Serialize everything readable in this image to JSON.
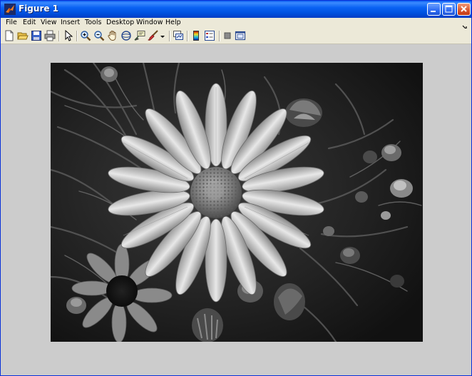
{
  "window": {
    "title": "Figure 1"
  },
  "menu": {
    "items": [
      "File",
      "Edit",
      "View",
      "Insert",
      "Tools",
      "Desktop",
      "Window",
      "Help"
    ]
  },
  "toolbar": {
    "buttons": [
      {
        "icon": "new-figure-icon"
      },
      {
        "icon": "open-file-icon"
      },
      {
        "icon": "save-icon"
      },
      {
        "icon": "print-icon"
      },
      {
        "icon": "edit-plot-arrow-icon"
      },
      {
        "icon": "zoom-in-icon"
      },
      {
        "icon": "zoom-out-icon"
      },
      {
        "icon": "pan-hand-icon"
      },
      {
        "icon": "rotate-3d-icon"
      },
      {
        "icon": "data-cursor-icon"
      },
      {
        "icon": "brush-icon"
      },
      {
        "icon": "link-plot-icon"
      },
      {
        "icon": "insert-colorbar-icon"
      },
      {
        "icon": "insert-legend-icon"
      },
      {
        "icon": "hide-plot-tools-icon"
      },
      {
        "icon": "show-plot-tools-icon"
      }
    ]
  },
  "figure": {
    "background": "#cccccc",
    "image": {
      "subject": "grayscale-daisy-photo-icon"
    }
  },
  "colors": {
    "title_bar": "#0a5cf0",
    "close_button": "#d8542c",
    "figure_background": "#cccccc",
    "chrome": "#ece9d8"
  }
}
